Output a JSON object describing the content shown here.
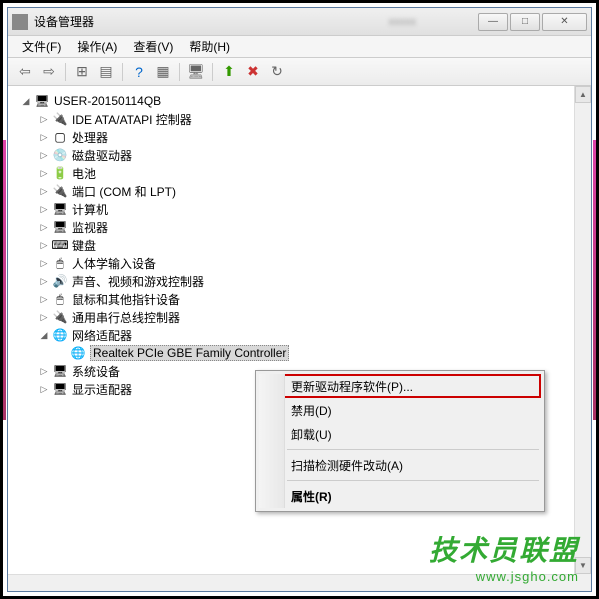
{
  "window": {
    "title": "设备管理器",
    "blur_text": "xxxxx"
  },
  "menubar": {
    "file": "文件(F)",
    "action": "操作(A)",
    "view": "查看(V)",
    "help": "帮助(H)"
  },
  "tree": {
    "root": "USER-20150114QB",
    "nodes": [
      {
        "label": "IDE ATA/ATAPI 控制器",
        "icon": "🔌"
      },
      {
        "label": "处理器",
        "icon": "▢"
      },
      {
        "label": "磁盘驱动器",
        "icon": "💿"
      },
      {
        "label": "电池",
        "icon": "🔋"
      },
      {
        "label": "端口 (COM 和 LPT)",
        "icon": "🔌"
      },
      {
        "label": "计算机",
        "icon": "🖥"
      },
      {
        "label": "监视器",
        "icon": "🖥"
      },
      {
        "label": "键盘",
        "icon": "⌨"
      },
      {
        "label": "人体学输入设备",
        "icon": "🖱"
      },
      {
        "label": "声音、视频和游戏控制器",
        "icon": "🔊"
      },
      {
        "label": "鼠标和其他指针设备",
        "icon": "🖱"
      },
      {
        "label": "通用串行总线控制器",
        "icon": "🔌"
      },
      {
        "label": "网络适配器",
        "icon": "🌐",
        "expanded": true,
        "children": [
          {
            "label": "Realtek PCIe GBE Family Controller",
            "selected": true
          }
        ]
      },
      {
        "label": "系统设备",
        "icon": "🖥"
      },
      {
        "label": "显示适配器",
        "icon": "🖥"
      }
    ]
  },
  "context_menu": {
    "items": [
      {
        "label": "更新驱动程序软件(P)...",
        "highlighted": true
      },
      {
        "label": "禁用(D)"
      },
      {
        "label": "卸载(U)"
      },
      {
        "sep": true
      },
      {
        "label": "扫描检测硬件改动(A)"
      },
      {
        "sep": true
      },
      {
        "label": "属性(R)",
        "bold": true
      }
    ]
  },
  "watermark": {
    "text": "技术员联盟",
    "url": "www.jsgho.com"
  }
}
